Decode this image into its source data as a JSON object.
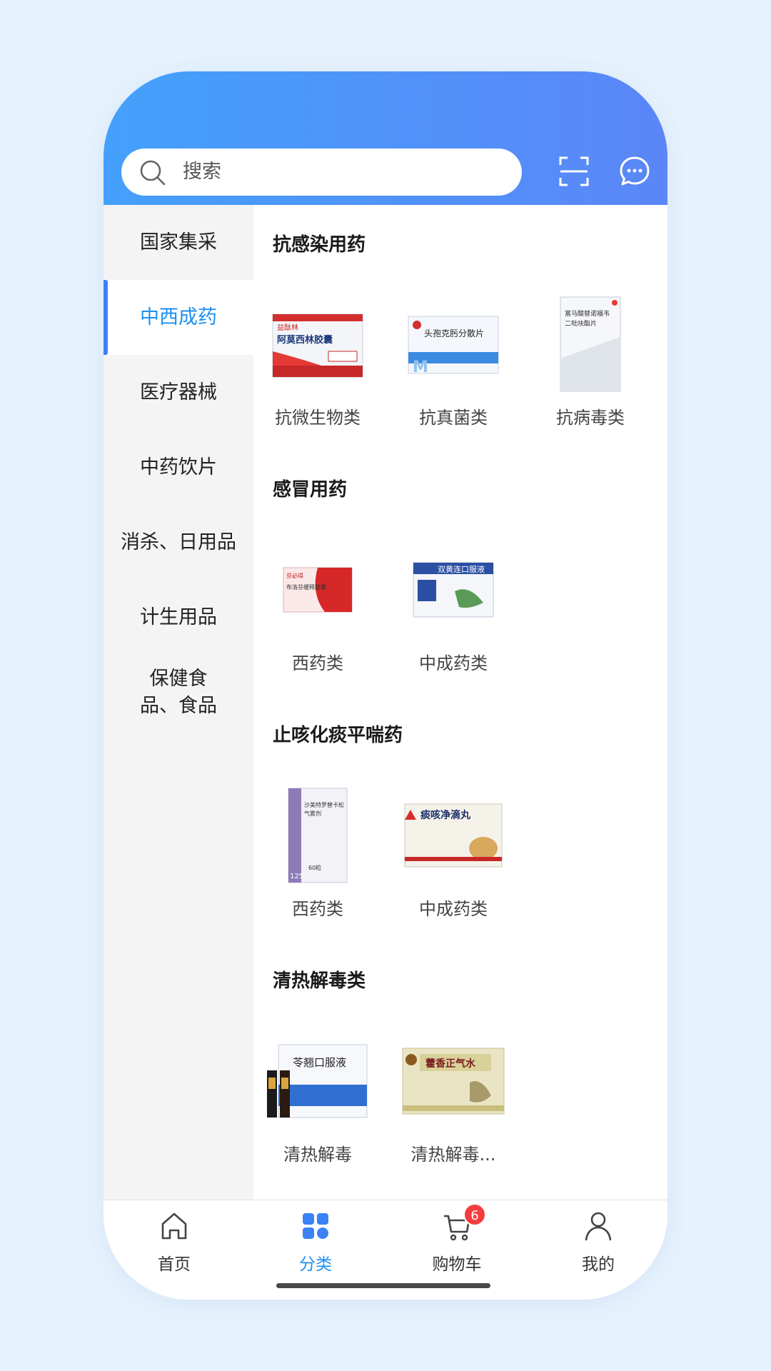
{
  "header": {
    "search_placeholder": "搜索",
    "icons": [
      "search-icon",
      "scan-icon",
      "message-icon"
    ]
  },
  "sidebar": {
    "items": [
      {
        "label": "国家集采"
      },
      {
        "label": "中西成药",
        "active": true
      },
      {
        "label": "医疗器械"
      },
      {
        "label": "中药饮片"
      },
      {
        "label": "消杀、日用品"
      },
      {
        "label": "计生用品"
      },
      {
        "label": "保健食品、食品"
      }
    ]
  },
  "sections": [
    {
      "title": "抗感染用药",
      "products": [
        {
          "label": "抗微生物类",
          "box_text": "阿莫西林胶囊",
          "box_top": "益酞林"
        },
        {
          "label": "抗真菌类",
          "box_text": "头孢克肟分散片"
        },
        {
          "label": "抗病毒类",
          "box_text": "富马酸替诺福韦二吡呋酯片"
        }
      ]
    },
    {
      "title": "感冒用药",
      "products": [
        {
          "label": "西药类",
          "box_text": "布洛芬缓释胶囊",
          "box_top": "芬必得"
        },
        {
          "label": "中成药类",
          "box_text": "双黄连口服液"
        }
      ]
    },
    {
      "title": "止咳化痰平喘药",
      "products": [
        {
          "label": "西药类",
          "box_text": "沙美特罗替卡松气雾剂",
          "box_num": "125",
          "box_count": "60粒"
        },
        {
          "label": "中成药类",
          "box_text": "痰咳净滴丸"
        }
      ]
    },
    {
      "title": "清热解毒类",
      "products": [
        {
          "label": "清热解毒",
          "box_text": "苓翘口服液"
        },
        {
          "label": "清热解毒...",
          "box_text": "藿香正气水"
        }
      ]
    }
  ],
  "tabbar": {
    "tabs": [
      {
        "label": "首页",
        "icon": "home-icon"
      },
      {
        "label": "分类",
        "icon": "category-icon",
        "active": true
      },
      {
        "label": "购物车",
        "icon": "cart-icon",
        "badge": "6"
      },
      {
        "label": "我的",
        "icon": "profile-icon"
      }
    ]
  },
  "colors": {
    "accent": "#1e8ff0",
    "header_start": "#44a0fb",
    "header_end": "#5b86f7",
    "badge": "#f33d3d",
    "page_bg": "#e6f2fd"
  }
}
